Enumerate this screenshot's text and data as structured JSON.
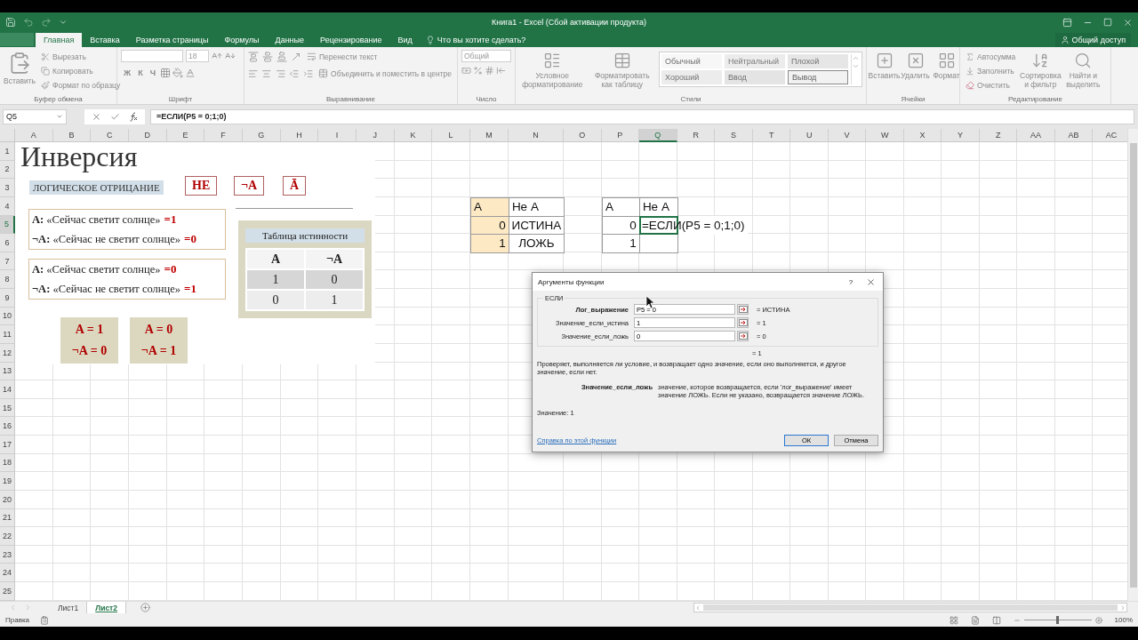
{
  "window": {
    "title": "Книга1 - Excel (Сбой активации продукта)"
  },
  "ribbon_tabs": [
    {
      "label": "Главная",
      "selected": true
    },
    {
      "label": "Вставка",
      "selected": false
    },
    {
      "label": "Разметка страницы",
      "selected": false
    },
    {
      "label": "Формулы",
      "selected": false
    },
    {
      "label": "Данные",
      "selected": false
    },
    {
      "label": "Рецензирование",
      "selected": false
    },
    {
      "label": "Вид",
      "selected": false
    }
  ],
  "tell_me": {
    "placeholder": "Что вы хотите сделать?"
  },
  "share_button": "Общий доступ",
  "ribbon": {
    "clipboard": {
      "paste": "Вставить",
      "items": [
        "Вырезать",
        "Копировать",
        "Формат по образцу"
      ],
      "label": "Буфер обмена"
    },
    "font": {
      "size": "18",
      "styles": [
        "Ж",
        "К",
        "Ч"
      ],
      "label": "Шрифт"
    },
    "alignment": {
      "wrap": "Перенести текст",
      "merge": "Объединить и поместить в центре",
      "label": "Выравнивание"
    },
    "number": {
      "format": "Общий",
      "label": "Число"
    },
    "styles": {
      "buttons": [
        "Условное форматирование",
        "Форматировать как таблицу"
      ],
      "gallery": [
        {
          "label": "Обычный",
          "kind": "normal"
        },
        {
          "label": "Нейтральный",
          "kind": "neutral"
        },
        {
          "label": "Плохой",
          "kind": "bad"
        },
        {
          "label": "Хороший",
          "kind": "good"
        },
        {
          "label": "Ввод",
          "kind": "input"
        },
        {
          "label": "Вывод",
          "kind": "output"
        }
      ],
      "label": "Стили"
    },
    "cells": {
      "buttons": [
        "Вставить",
        "Удалить",
        "Формат"
      ],
      "label": "Ячейки"
    },
    "editing": {
      "items": [
        "Автосумма",
        "Заполнить",
        "Очистить"
      ],
      "buttons": [
        "Сортировка и фильтр",
        "Найти и выделить"
      ],
      "label": "Редактирование"
    }
  },
  "formula_bar": {
    "name_box": "Q5",
    "formula": "=ЕСЛИ(P5 = 0;1;0)"
  },
  "column_headers": [
    {
      "label": "A",
      "selected": false
    },
    {
      "label": "B",
      "selected": false
    },
    {
      "label": "C",
      "selected": false
    },
    {
      "label": "D",
      "selected": false
    },
    {
      "label": "E",
      "selected": false
    },
    {
      "label": "F",
      "selected": false
    },
    {
      "label": "G",
      "selected": false
    },
    {
      "label": "H",
      "selected": false
    },
    {
      "label": "I",
      "selected": false
    },
    {
      "label": "J",
      "selected": false
    },
    {
      "label": "K",
      "selected": false
    },
    {
      "label": "L",
      "selected": false
    },
    {
      "label": "M",
      "selected": false
    },
    {
      "label": "N",
      "selected": false
    },
    {
      "label": "O",
      "selected": false
    },
    {
      "label": "P",
      "selected": false
    },
    {
      "label": "Q",
      "selected": true
    },
    {
      "label": "R",
      "selected": false
    },
    {
      "label": "S",
      "selected": false
    },
    {
      "label": "T",
      "selected": false
    },
    {
      "label": "U",
      "selected": false
    },
    {
      "label": "V",
      "selected": false
    },
    {
      "label": "W",
      "selected": false
    },
    {
      "label": "X",
      "selected": false
    },
    {
      "label": "Y",
      "selected": false
    },
    {
      "label": "Z",
      "selected": false
    },
    {
      "label": "AA",
      "selected": false
    },
    {
      "label": "AB",
      "selected": false
    },
    {
      "label": "AC",
      "selected": false
    }
  ],
  "row_headers": [
    {
      "label": "1",
      "selected": false
    },
    {
      "label": "2",
      "selected": false
    },
    {
      "label": "3",
      "selected": false
    },
    {
      "label": "4",
      "selected": false
    },
    {
      "label": "5",
      "selected": true
    },
    {
      "label": "6",
      "selected": false
    },
    {
      "label": "7",
      "selected": false
    },
    {
      "label": "8",
      "selected": false
    },
    {
      "label": "9",
      "selected": false
    },
    {
      "label": "10",
      "selected": false
    },
    {
      "label": "11",
      "selected": false
    },
    {
      "label": "12",
      "selected": false
    },
    {
      "label": "13",
      "selected": false
    },
    {
      "label": "14",
      "selected": false
    },
    {
      "label": "15",
      "selected": false
    },
    {
      "label": "16",
      "selected": false
    },
    {
      "label": "17",
      "selected": false
    },
    {
      "label": "18",
      "selected": false
    },
    {
      "label": "19",
      "selected": false
    },
    {
      "label": "20",
      "selected": false
    },
    {
      "label": "21",
      "selected": false
    },
    {
      "label": "22",
      "selected": false
    },
    {
      "label": "23",
      "selected": false
    },
    {
      "label": "24",
      "selected": false
    },
    {
      "label": "25",
      "selected": false
    }
  ],
  "slide": {
    "title": "Инверсия",
    "subtitle": "ЛОГИЧЕСКОЕ ОТРИЦАНИЕ",
    "notations": [
      "НЕ",
      "¬A",
      "Ā"
    ],
    "statements": [
      {
        "lines": [
          {
            "text": "**A:** «Сейчас светит солнце»",
            "value": "=1"
          },
          {
            "text": "**¬A:** «Сейчас не светит солнце»",
            "value": "=0"
          }
        ]
      },
      {
        "lines": [
          {
            "text": "**A:** «Сейчас светит солнце»",
            "value": "=0"
          },
          {
            "text": "**¬A:** «Сейчас не светит солнце»",
            "value": "=1"
          }
        ]
      }
    ],
    "truth_table": {
      "title": "Таблица истинности",
      "columns": [
        "A",
        "¬A"
      ],
      "rows": [
        [
          "1",
          "0"
        ],
        [
          "0",
          "1"
        ]
      ]
    },
    "cards": [
      {
        "lines": [
          "A = 1",
          "¬A = 0"
        ]
      },
      {
        "lines": [
          "A = 0",
          "¬A = 1"
        ]
      }
    ]
  },
  "cell_tables": [
    {
      "rows": [
        [
          {
            "text": "A",
            "kind": "text",
            "highlighted": true,
            "selected": false
          },
          {
            "text": "Не A",
            "kind": "text",
            "highlighted": false,
            "selected": false
          }
        ],
        [
          {
            "text": "0",
            "kind": "number",
            "highlighted": true,
            "selected": false
          },
          {
            "text": "ИСТИНА",
            "kind": "centered",
            "highlighted": false,
            "selected": false
          }
        ],
        [
          {
            "text": "1",
            "kind": "number",
            "highlighted": true,
            "selected": false
          },
          {
            "text": "ЛОЖЬ",
            "kind": "centered",
            "highlighted": false,
            "selected": false
          }
        ]
      ]
    },
    {
      "rows": [
        [
          {
            "text": "A",
            "kind": "text",
            "highlighted": false,
            "selected": false
          },
          {
            "text": "Не A",
            "kind": "text",
            "highlighted": false,
            "selected": false
          }
        ],
        [
          {
            "text": "0",
            "kind": "number",
            "highlighted": false,
            "selected": false
          },
          {
            "text": "=ЕСЛИ(P5 = 0;1;0)",
            "kind": "formula",
            "highlighted": false,
            "selected": true
          }
        ],
        [
          {
            "text": "1",
            "kind": "number",
            "highlighted": false,
            "selected": false
          },
          {
            "kind": "text",
            "highlighted": false,
            "selected": false
          }
        ]
      ]
    }
  ],
  "dialog": {
    "title": "Аргументы функции",
    "help": "?",
    "function": "ЕСЛИ",
    "arguments": [
      {
        "label": "Лог_выражение",
        "value": "P5 = 0",
        "result": "=  ИСТИНА",
        "required": true
      },
      {
        "label": "Значение_если_истина",
        "value": "1",
        "result": "=  1",
        "required": false
      },
      {
        "label": "Значение_если_ложь",
        "value": "0",
        "result": "=  0",
        "required": false
      }
    ],
    "formula_result": "=  1",
    "description": "Проверяет, выполняется ли условие, и возвращает одно значение, если оно выполняется, и другое значение, если нет.",
    "argument_help": {
      "name": "Значение_если_ложь",
      "text": "значение, которое возвращается, если 'лог_выражение' имеет значение ЛОЖЬ. Если не указано, возвращается значение ЛОЖЬ."
    },
    "value": "Значение:  1",
    "help_link": "Справка по этой функции",
    "buttons": [
      {
        "label": "ОК",
        "default": true
      },
      {
        "label": "Отмена",
        "default": false
      }
    ]
  },
  "sheet_tabs": [
    {
      "label": "Лист1",
      "selected": false
    },
    {
      "label": "Лист2",
      "selected": true
    }
  ],
  "status_bar": {
    "mode": "Правка",
    "zoom": {
      "level": 0.5,
      "reading": "100%"
    }
  }
}
